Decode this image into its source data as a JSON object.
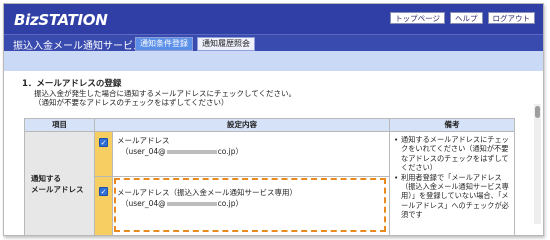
{
  "header": {
    "logo": "BizSTATION",
    "links": [
      "トップページ",
      "ヘルプ",
      "ログアウト"
    ],
    "service_title": "振込入金メール通知サービス",
    "tabs": [
      {
        "label": "通知条件登録",
        "active": true
      },
      {
        "label": "通知履歴照会",
        "active": false
      }
    ]
  },
  "section": {
    "title": "1．メールアドレスの登録",
    "desc1": "振込入金が発生した場合に通知するメールアドレスにチェックしてください。",
    "desc2": "（通知が不要なアドレスのチェックをはずしてください）"
  },
  "table": {
    "headers": [
      "項目",
      "設定内容",
      "備考"
    ],
    "item_label_line1": "通知する",
    "item_label_line2": "メールアドレス",
    "rows": [
      {
        "label": "メールアドレス",
        "email_prefix": "（user_04@",
        "email_suffix": "co.jp）",
        "checked": true
      },
      {
        "label": "メールアドレス（振込入金メール通知サービス専用）",
        "email_prefix": "（user_04@",
        "email_suffix": "co.jp）",
        "checked": true
      }
    ],
    "remarks": [
      "通知するメールアドレスにチェックをいれてください（通知が不要なアドレスのチェックをはずしてください）",
      "利用者登録で「メールアドレス（振込入金メール通知サービス専用）」を登録していない場合、「メールアドレス」へのチェックが必須です"
    ]
  },
  "colors": {
    "brand_blue": "#2f3fa6",
    "highlight_orange": "#e88a1f",
    "checkbox_column": "#f6ce62"
  }
}
